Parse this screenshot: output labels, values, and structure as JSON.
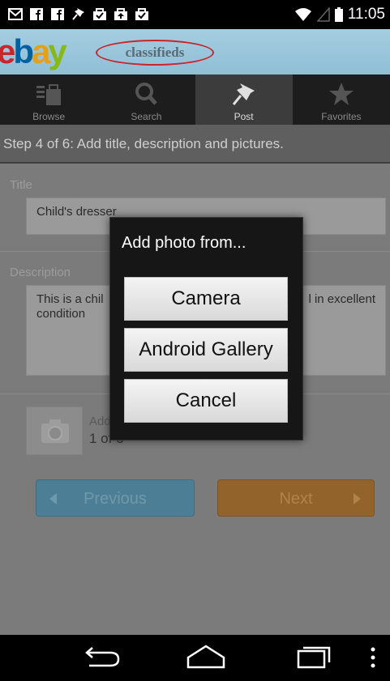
{
  "status_bar": {
    "time": "11:05",
    "icons": [
      "gmail-icon",
      "facebook-icon",
      "facebook-icon",
      "pin-icon",
      "bag-check-icon",
      "bag-upload-icon",
      "bag-check-icon"
    ]
  },
  "header": {
    "logo_letters": [
      "e",
      "b",
      "a",
      "y"
    ],
    "logo_colors": [
      "#c8252c",
      "#0060a0",
      "#e3a117",
      "#86b817"
    ],
    "subtitle": "classifieds"
  },
  "tabs": [
    {
      "label": "Browse",
      "icon": "shopping-bag-icon",
      "active": false
    },
    {
      "label": "Search",
      "icon": "search-icon",
      "active": false
    },
    {
      "label": "Post",
      "icon": "pin-icon",
      "active": true
    },
    {
      "label": "Favorites",
      "icon": "star-icon",
      "active": false
    }
  ],
  "step_text": "Step 4 of 6: Add title, description and pictures.",
  "form": {
    "title_label": "Title",
    "title_value": "Child's dresser",
    "description_label": "Description",
    "description_value_start": "This is a chil",
    "description_value_end": "l in excellent",
    "description_value_line2": "condition",
    "photos_line1": "Add",
    "photos_line2": "1 of 6"
  },
  "buttons": {
    "previous": "Previous",
    "next": "Next"
  },
  "dialog": {
    "title": "Add photo from...",
    "options": [
      "Camera",
      "Android Gallery",
      "Cancel"
    ]
  },
  "nav": [
    "back-icon",
    "home-icon",
    "recent-apps-icon",
    "overflow-menu-icon"
  ],
  "colors": {
    "header_blue": "#a5cde0",
    "previous_blue": "#4c7f95",
    "next_orange": "#92632a"
  }
}
